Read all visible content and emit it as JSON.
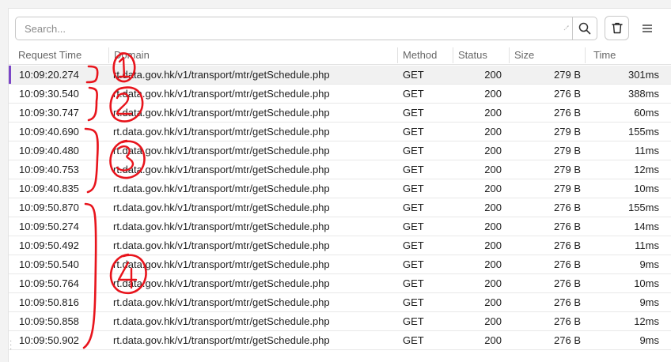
{
  "search": {
    "placeholder": "Search..."
  },
  "toolbar": {
    "search_icon": "search-icon",
    "trash_icon": "trash-icon",
    "menu_icon": "hamburger-menu-icon"
  },
  "columns": [
    "Request Time",
    "Domain",
    "Method",
    "Status",
    "Size",
    "Time"
  ],
  "rows": [
    {
      "time": "10:09:20.274",
      "domain": "rt.data.gov.hk/v1/transport/mtr/getSchedule.php",
      "method": "GET",
      "status": "200",
      "size": "279 B",
      "duration": "301ms",
      "selected": true
    },
    {
      "time": "10:09:30.540",
      "domain": "rt.data.gov.hk/v1/transport/mtr/getSchedule.php",
      "method": "GET",
      "status": "200",
      "size": "276 B",
      "duration": "388ms"
    },
    {
      "time": "10:09:30.747",
      "domain": "rt.data.gov.hk/v1/transport/mtr/getSchedule.php",
      "method": "GET",
      "status": "200",
      "size": "276 B",
      "duration": "60ms"
    },
    {
      "time": "10:09:40.690",
      "domain": "rt.data.gov.hk/v1/transport/mtr/getSchedule.php",
      "method": "GET",
      "status": "200",
      "size": "279 B",
      "duration": "155ms"
    },
    {
      "time": "10:09:40.480",
      "domain": "rt.data.gov.hk/v1/transport/mtr/getSchedule.php",
      "method": "GET",
      "status": "200",
      "size": "279 B",
      "duration": "11ms"
    },
    {
      "time": "10:09:40.753",
      "domain": "rt.data.gov.hk/v1/transport/mtr/getSchedule.php",
      "method": "GET",
      "status": "200",
      "size": "279 B",
      "duration": "12ms"
    },
    {
      "time": "10:09:40.835",
      "domain": "rt.data.gov.hk/v1/transport/mtr/getSchedule.php",
      "method": "GET",
      "status": "200",
      "size": "279 B",
      "duration": "10ms"
    },
    {
      "time": "10:09:50.870",
      "domain": "rt.data.gov.hk/v1/transport/mtr/getSchedule.php",
      "method": "GET",
      "status": "200",
      "size": "276 B",
      "duration": "155ms"
    },
    {
      "time": "10:09:50.274",
      "domain": "rt.data.gov.hk/v1/transport/mtr/getSchedule.php",
      "method": "GET",
      "status": "200",
      "size": "276 B",
      "duration": "14ms"
    },
    {
      "time": "10:09:50.492",
      "domain": "rt.data.gov.hk/v1/transport/mtr/getSchedule.php",
      "method": "GET",
      "status": "200",
      "size": "276 B",
      "duration": "11ms"
    },
    {
      "time": "10:09:50.540",
      "domain": "rt.data.gov.hk/v1/transport/mtr/getSchedule.php",
      "method": "GET",
      "status": "200",
      "size": "276 B",
      "duration": "9ms"
    },
    {
      "time": "10:09:50.764",
      "domain": "rt.data.gov.hk/v1/transport/mtr/getSchedule.php",
      "method": "GET",
      "status": "200",
      "size": "276 B",
      "duration": "10ms"
    },
    {
      "time": "10:09:50.816",
      "domain": "rt.data.gov.hk/v1/transport/mtr/getSchedule.php",
      "method": "GET",
      "status": "200",
      "size": "276 B",
      "duration": "9ms"
    },
    {
      "time": "10:09:50.858",
      "domain": "rt.data.gov.hk/v1/transport/mtr/getSchedule.php",
      "method": "GET",
      "status": "200",
      "size": "276 B",
      "duration": "12ms"
    },
    {
      "time": "10:09:50.902",
      "domain": "rt.data.gov.hk/v1/transport/mtr/getSchedule.php",
      "method": "GET",
      "status": "200",
      "size": "276 B",
      "duration": "9ms"
    }
  ],
  "annotations": {
    "color": "#e8141c",
    "groups": [
      {
        "label": "1"
      },
      {
        "label": "2"
      },
      {
        "label": "3"
      },
      {
        "label": "4"
      }
    ]
  },
  "colors": {
    "accent": "#7b46c7",
    "annotation": "#e8141c"
  }
}
